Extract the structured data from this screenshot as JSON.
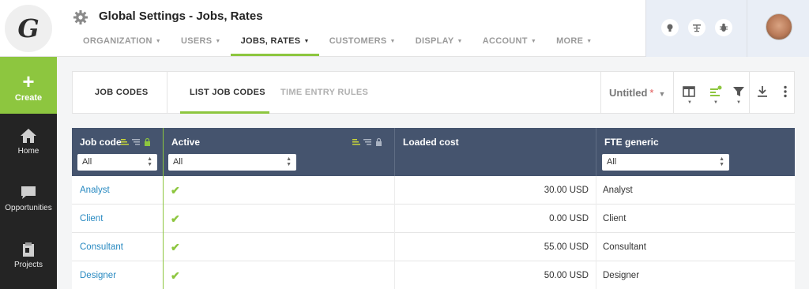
{
  "app": {
    "logo_letter": "G",
    "title": "Global Settings - Jobs, Rates"
  },
  "leftnav": {
    "create_label": "Create",
    "items": [
      {
        "label": "Home",
        "icon": "home-icon"
      },
      {
        "label": "Opportunities",
        "icon": "chat-bubble-icon"
      },
      {
        "label": "Projects",
        "icon": "projects-icon"
      }
    ]
  },
  "tabs": [
    {
      "label": "ORGANIZATION",
      "active": false
    },
    {
      "label": "USERS",
      "active": false
    },
    {
      "label": "JOBS, RATES",
      "active": true
    },
    {
      "label": "CUSTOMERS",
      "active": false
    },
    {
      "label": "DISPLAY",
      "active": false
    },
    {
      "label": "ACCOUNT",
      "active": false
    },
    {
      "label": "MORE",
      "active": false
    }
  ],
  "header_icons": [
    "lightbulb-icon",
    "scale-icon",
    "bug-icon"
  ],
  "toolbar": {
    "tab_job_codes": "JOB CODES",
    "tab_list_job_codes": "LIST JOB CODES",
    "tab_time_entry_rules": "TIME ENTRY RULES",
    "view_name": "Untitled",
    "view_modified_marker": "*"
  },
  "table": {
    "columns": [
      {
        "label": "Job code",
        "filter": "All"
      },
      {
        "label": "Active",
        "filter": "All"
      },
      {
        "label": "Loaded cost",
        "filter": ""
      },
      {
        "label": "FTE generic",
        "filter": "All"
      }
    ],
    "rows": [
      {
        "job_code": "Analyst",
        "active": "✔",
        "loaded_cost": "30.00 USD",
        "fte_generic": "Analyst"
      },
      {
        "job_code": "Client",
        "active": "✔",
        "loaded_cost": "0.00 USD",
        "fte_generic": "Client"
      },
      {
        "job_code": "Consultant",
        "active": "✔",
        "loaded_cost": "55.00 USD",
        "fte_generic": "Consultant"
      },
      {
        "job_code": "Designer",
        "active": "✔",
        "loaded_cost": "50.00 USD",
        "fte_generic": "Designer"
      }
    ]
  },
  "colors": {
    "accent": "#8dc63f",
    "header_bg": "#45546e",
    "link": "#2789c1",
    "nav_bg": "#242424"
  }
}
